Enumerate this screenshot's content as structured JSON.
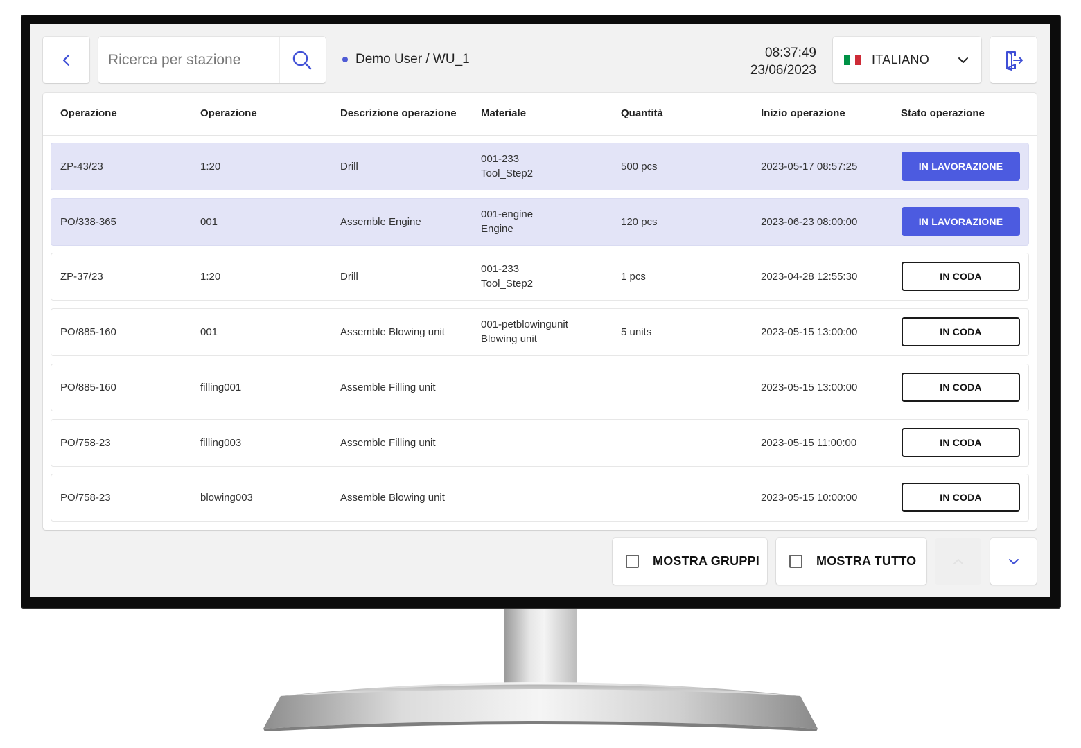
{
  "header": {
    "search_placeholder": "Ricerca per stazione",
    "user": "Demo User / WU_1",
    "time": "08:37:49",
    "date": "23/06/2023",
    "language": "ITALIANO",
    "flag_colors": [
      "#009246",
      "#ffffff",
      "#ce2b37"
    ]
  },
  "table": {
    "columns": [
      "Operazione",
      "Operazione",
      "Descrizione operazione",
      "Materiale",
      "Quantità",
      "Inizio operazione",
      "Stato operazione"
    ],
    "rows": [
      {
        "order": "ZP-43/23",
        "op": "1:20",
        "desc": "Drill",
        "mat1": "001-233",
        "mat2": "Tool_Step2",
        "qty": "500 pcs",
        "start": "2023-05-17 08:57:25",
        "status": "IN LAVORAZIONE",
        "active": true
      },
      {
        "order": "PO/338-365",
        "op": "001",
        "desc": "Assemble Engine",
        "mat1": "001-engine",
        "mat2": "Engine",
        "qty": "120 pcs",
        "start": "2023-06-23 08:00:00",
        "status": "IN LAVORAZIONE",
        "active": true
      },
      {
        "order": "ZP-37/23",
        "op": "1:20",
        "desc": "Drill",
        "mat1": "001-233",
        "mat2": "Tool_Step2",
        "qty": "1 pcs",
        "start": "2023-04-28 12:55:30",
        "status": "IN CODA",
        "active": false
      },
      {
        "order": "PO/885-160",
        "op": "001",
        "desc": "Assemble Blowing unit",
        "mat1": "001-petblowingunit",
        "mat2": "Blowing unit",
        "qty": "5 units",
        "start": "2023-05-15 13:00:00",
        "status": "IN CODA",
        "active": false
      },
      {
        "order": "PO/885-160",
        "op": "filling001",
        "desc": "Assemble Filling unit",
        "mat1": "",
        "mat2": "",
        "qty": "",
        "start": "2023-05-15 13:00:00",
        "status": "IN CODA",
        "active": false
      },
      {
        "order": "PO/758-23",
        "op": "filling003",
        "desc": "Assemble Filling unit",
        "mat1": "",
        "mat2": "",
        "qty": "",
        "start": "2023-05-15 11:00:00",
        "status": "IN CODA",
        "active": false
      },
      {
        "order": "PO/758-23",
        "op": "blowing003",
        "desc": "Assemble Blowing unit",
        "mat1": "",
        "mat2": "",
        "qty": "",
        "start": "2023-05-15 10:00:00",
        "status": "IN CODA",
        "active": false
      }
    ]
  },
  "footer": {
    "show_groups": "MOSTRA GRUPPI",
    "show_all": "MOSTRA TUTTO"
  },
  "colors": {
    "accent": "#4c5be0",
    "active_row": "#e3e4f7"
  }
}
